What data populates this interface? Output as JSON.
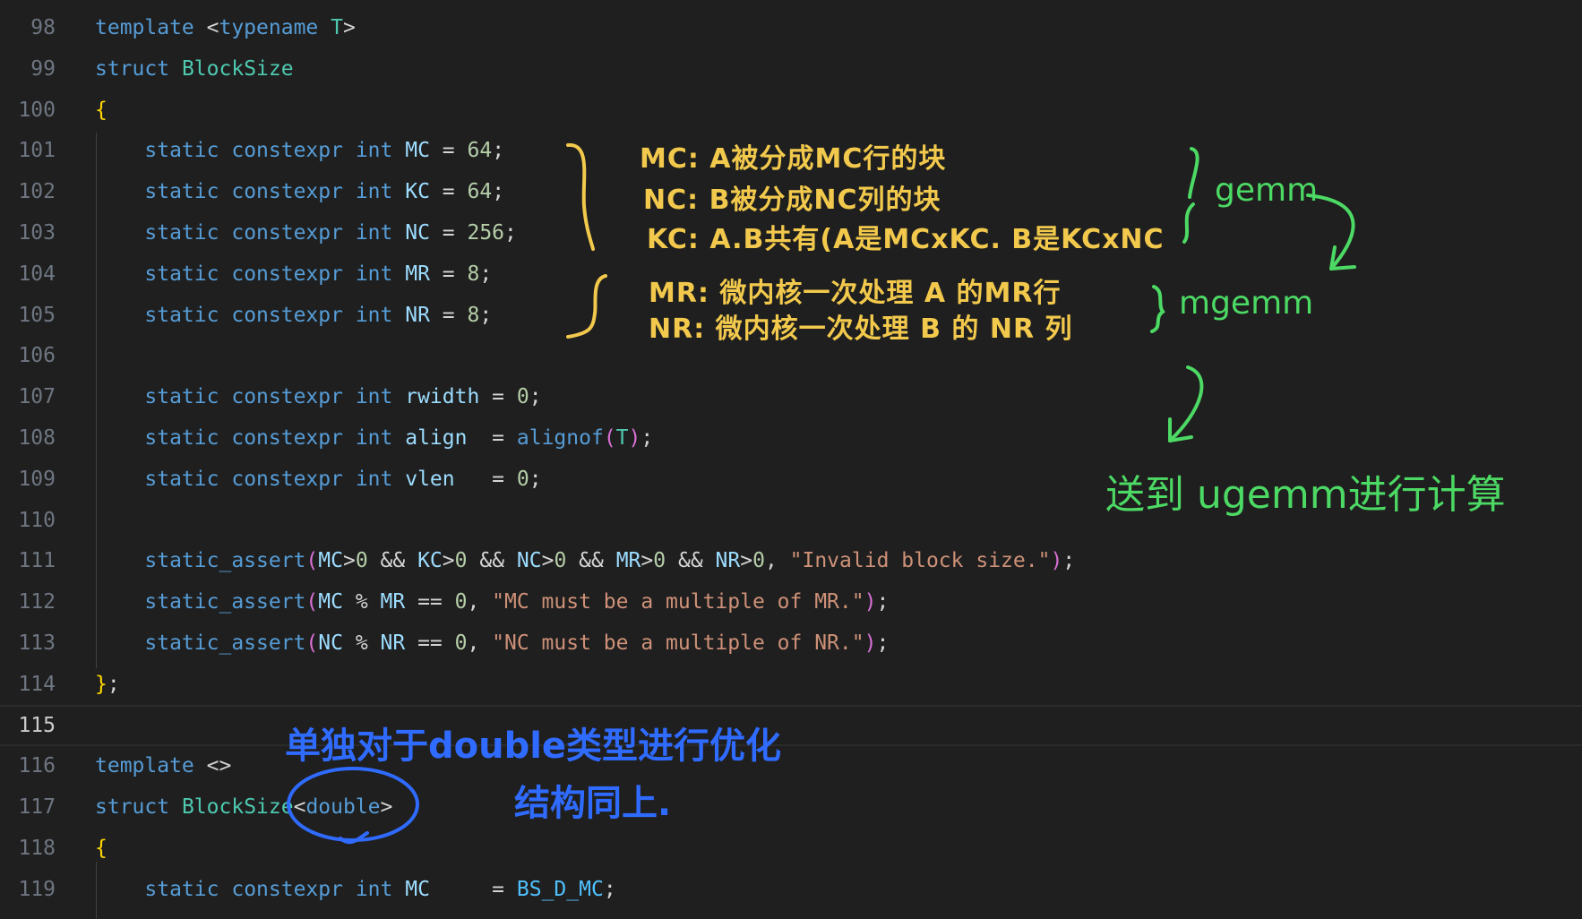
{
  "lines": [
    {
      "n": "98",
      "tokens": [
        [
          "kw",
          "template"
        ],
        [
          "op",
          " <"
        ],
        [
          "kw",
          "typename"
        ],
        [
          "op",
          " "
        ],
        [
          "ty",
          "T"
        ],
        [
          "op",
          ">"
        ]
      ]
    },
    {
      "n": "99",
      "tokens": [
        [
          "kw",
          "struct"
        ],
        [
          "op",
          " "
        ],
        [
          "ty",
          "BlockSize"
        ]
      ]
    },
    {
      "n": "100",
      "tokens": [
        [
          "br",
          "{"
        ]
      ]
    },
    {
      "n": "101",
      "tokens": [
        [
          "op",
          "    "
        ],
        [
          "kw",
          "static"
        ],
        [
          "op",
          " "
        ],
        [
          "kw",
          "constexpr"
        ],
        [
          "op",
          " "
        ],
        [
          "kw",
          "int"
        ],
        [
          "op",
          " "
        ],
        [
          "id",
          "MC"
        ],
        [
          "op",
          " = "
        ],
        [
          "num",
          "64"
        ],
        [
          "op",
          ";"
        ]
      ]
    },
    {
      "n": "102",
      "tokens": [
        [
          "op",
          "    "
        ],
        [
          "kw",
          "static"
        ],
        [
          "op",
          " "
        ],
        [
          "kw",
          "constexpr"
        ],
        [
          "op",
          " "
        ],
        [
          "kw",
          "int"
        ],
        [
          "op",
          " "
        ],
        [
          "id",
          "KC"
        ],
        [
          "op",
          " = "
        ],
        [
          "num",
          "64"
        ],
        [
          "op",
          ";"
        ]
      ]
    },
    {
      "n": "103",
      "tokens": [
        [
          "op",
          "    "
        ],
        [
          "kw",
          "static"
        ],
        [
          "op",
          " "
        ],
        [
          "kw",
          "constexpr"
        ],
        [
          "op",
          " "
        ],
        [
          "kw",
          "int"
        ],
        [
          "op",
          " "
        ],
        [
          "id",
          "NC"
        ],
        [
          "op",
          " = "
        ],
        [
          "num",
          "256"
        ],
        [
          "op",
          ";"
        ]
      ]
    },
    {
      "n": "104",
      "tokens": [
        [
          "op",
          "    "
        ],
        [
          "kw",
          "static"
        ],
        [
          "op",
          " "
        ],
        [
          "kw",
          "constexpr"
        ],
        [
          "op",
          " "
        ],
        [
          "kw",
          "int"
        ],
        [
          "op",
          " "
        ],
        [
          "id",
          "MR"
        ],
        [
          "op",
          " = "
        ],
        [
          "num",
          "8"
        ],
        [
          "op",
          ";"
        ]
      ]
    },
    {
      "n": "105",
      "tokens": [
        [
          "op",
          "    "
        ],
        [
          "kw",
          "static"
        ],
        [
          "op",
          " "
        ],
        [
          "kw",
          "constexpr"
        ],
        [
          "op",
          " "
        ],
        [
          "kw",
          "int"
        ],
        [
          "op",
          " "
        ],
        [
          "id",
          "NR"
        ],
        [
          "op",
          " = "
        ],
        [
          "num",
          "8"
        ],
        [
          "op",
          ";"
        ]
      ]
    },
    {
      "n": "106",
      "tokens": []
    },
    {
      "n": "107",
      "tokens": [
        [
          "op",
          "    "
        ],
        [
          "kw",
          "static"
        ],
        [
          "op",
          " "
        ],
        [
          "kw",
          "constexpr"
        ],
        [
          "op",
          " "
        ],
        [
          "kw",
          "int"
        ],
        [
          "op",
          " "
        ],
        [
          "id",
          "rwidth"
        ],
        [
          "op",
          " = "
        ],
        [
          "num",
          "0"
        ],
        [
          "op",
          ";"
        ]
      ]
    },
    {
      "n": "108",
      "tokens": [
        [
          "op",
          "    "
        ],
        [
          "kw",
          "static"
        ],
        [
          "op",
          " "
        ],
        [
          "kw",
          "constexpr"
        ],
        [
          "op",
          " "
        ],
        [
          "kw",
          "int"
        ],
        [
          "op",
          " "
        ],
        [
          "id",
          "align"
        ],
        [
          "op",
          "  = "
        ],
        [
          "fn2",
          "alignof"
        ],
        [
          "br2",
          "("
        ],
        [
          "ty",
          "T"
        ],
        [
          "br2",
          ")"
        ],
        [
          "op",
          ";"
        ]
      ]
    },
    {
      "n": "109",
      "tokens": [
        [
          "op",
          "    "
        ],
        [
          "kw",
          "static"
        ],
        [
          "op",
          " "
        ],
        [
          "kw",
          "constexpr"
        ],
        [
          "op",
          " "
        ],
        [
          "kw",
          "int"
        ],
        [
          "op",
          " "
        ],
        [
          "id",
          "vlen"
        ],
        [
          "op",
          "   = "
        ],
        [
          "num",
          "0"
        ],
        [
          "op",
          ";"
        ]
      ]
    },
    {
      "n": "110",
      "tokens": []
    },
    {
      "n": "111",
      "tokens": [
        [
          "op",
          "    "
        ],
        [
          "fn2",
          "static_assert"
        ],
        [
          "br2",
          "("
        ],
        [
          "id",
          "MC"
        ],
        [
          "op",
          ">"
        ],
        [
          "num",
          "0"
        ],
        [
          "op",
          " && "
        ],
        [
          "id",
          "KC"
        ],
        [
          "op",
          ">"
        ],
        [
          "num",
          "0"
        ],
        [
          "op",
          " && "
        ],
        [
          "id",
          "NC"
        ],
        [
          "op",
          ">"
        ],
        [
          "num",
          "0"
        ],
        [
          "op",
          " && "
        ],
        [
          "id",
          "MR"
        ],
        [
          "op",
          ">"
        ],
        [
          "num",
          "0"
        ],
        [
          "op",
          " && "
        ],
        [
          "id",
          "NR"
        ],
        [
          "op",
          ">"
        ],
        [
          "num",
          "0"
        ],
        [
          "op",
          ", "
        ],
        [
          "str",
          "\"Invalid block size.\""
        ],
        [
          "br2",
          ")"
        ],
        [
          "op",
          ";"
        ]
      ]
    },
    {
      "n": "112",
      "tokens": [
        [
          "op",
          "    "
        ],
        [
          "fn2",
          "static_assert"
        ],
        [
          "br2",
          "("
        ],
        [
          "id",
          "MC"
        ],
        [
          "op",
          " % "
        ],
        [
          "id",
          "MR"
        ],
        [
          "op",
          " == "
        ],
        [
          "num",
          "0"
        ],
        [
          "op",
          ", "
        ],
        [
          "str",
          "\"MC must be a multiple of MR.\""
        ],
        [
          "br2",
          ")"
        ],
        [
          "op",
          ";"
        ]
      ]
    },
    {
      "n": "113",
      "tokens": [
        [
          "op",
          "    "
        ],
        [
          "fn2",
          "static_assert"
        ],
        [
          "br2",
          "("
        ],
        [
          "id",
          "NC"
        ],
        [
          "op",
          " % "
        ],
        [
          "id",
          "NR"
        ],
        [
          "op",
          " == "
        ],
        [
          "num",
          "0"
        ],
        [
          "op",
          ", "
        ],
        [
          "str",
          "\"NC must be a multiple of NR.\""
        ],
        [
          "br2",
          ")"
        ],
        [
          "op",
          ";"
        ]
      ]
    },
    {
      "n": "114",
      "tokens": [
        [
          "br",
          "}"
        ],
        [
          "op",
          ";"
        ]
      ]
    },
    {
      "n": "115",
      "tokens": [],
      "active": true
    },
    {
      "n": "116",
      "tokens": [
        [
          "kw",
          "template"
        ],
        [
          "op",
          " <>"
        ]
      ]
    },
    {
      "n": "117",
      "tokens": [
        [
          "kw",
          "struct"
        ],
        [
          "op",
          " "
        ],
        [
          "ty",
          "BlockSize"
        ],
        [
          "op",
          "<"
        ],
        [
          "kw",
          "double"
        ],
        [
          "op",
          ">"
        ]
      ]
    },
    {
      "n": "118",
      "tokens": [
        [
          "br",
          "{"
        ]
      ]
    },
    {
      "n": "119",
      "tokens": [
        [
          "op",
          "    "
        ],
        [
          "kw",
          "static"
        ],
        [
          "op",
          " "
        ],
        [
          "kw",
          "constexpr"
        ],
        [
          "op",
          " "
        ],
        [
          "kw",
          "int"
        ],
        [
          "op",
          " "
        ],
        [
          "id",
          "MC"
        ],
        [
          "op",
          "     = "
        ],
        [
          "macro",
          "BS_D_MC"
        ],
        [
          "op",
          ";"
        ]
      ]
    }
  ],
  "annotations": {
    "yellow_1": "MC: A被分成MC行的块",
    "yellow_2": "NC: B被分成NC列的块",
    "yellow_3": "KC: A.B共有(A是MCxKC. B是KCxNC",
    "yellow_4": "MR: 微内核一次处理 A 的MR行",
    "yellow_5": "NR: 微内核一次处理 B 的 NR 列",
    "green_gemm": "gemm",
    "green_mgemm": "mgemm",
    "green_send": "送到 ugemm进行计算",
    "blue_1": "单独对于double类型进行优化",
    "blue_2": "结构同上."
  }
}
